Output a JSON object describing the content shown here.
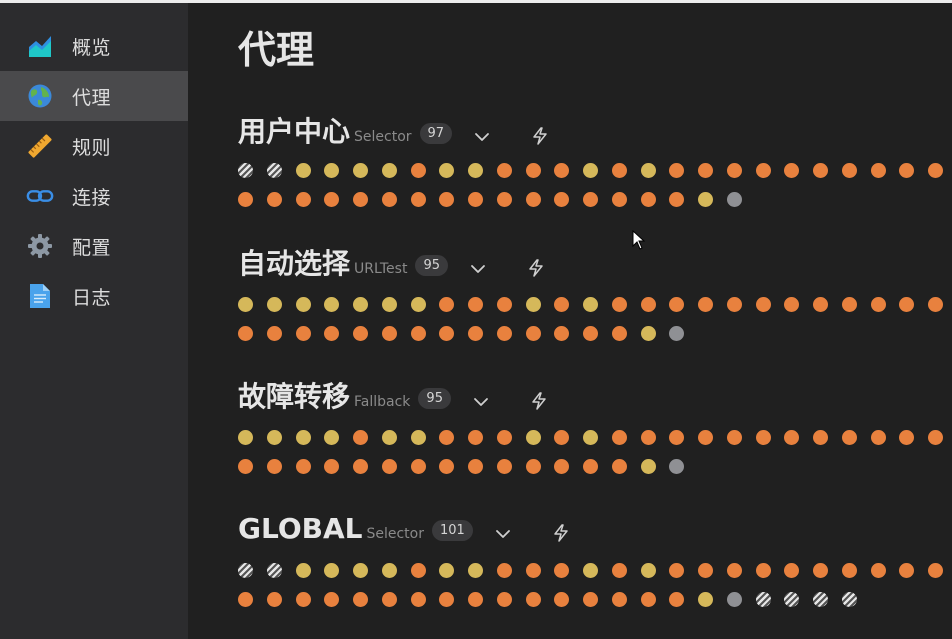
{
  "sidebar": {
    "items": [
      {
        "label": "概览",
        "icon": "chart-area-icon",
        "active": false
      },
      {
        "label": "代理",
        "icon": "globe-icon",
        "active": true
      },
      {
        "label": "规则",
        "icon": "ruler-icon",
        "active": false
      },
      {
        "label": "连接",
        "icon": "link-icon",
        "active": false
      },
      {
        "label": "配置",
        "icon": "gear-icon",
        "active": false
      },
      {
        "label": "日志",
        "icon": "document-icon",
        "active": false
      }
    ]
  },
  "page": {
    "title": "代理"
  },
  "groups": [
    {
      "name": "用户中心",
      "type": "Selector",
      "count": "97",
      "rows": [
        "SSYYYYOYYOOOYOYOOOOOOOOOOO",
        "OOOOOOOOOOOOOOOOYG"
      ]
    },
    {
      "name": "自动选择",
      "type": "URLTest",
      "count": "95",
      "rows": [
        "YYYYYYYOOOYOYOOOOOOOOOOOOO",
        "OOOOOOOOOOOOOOYG"
      ]
    },
    {
      "name": "故障转移",
      "type": "Fallback",
      "count": "95",
      "rows": [
        "YYYYOYYOOOYOYOOOOOOOOOOOOO",
        "OOOOOOOOOOOOOOYG"
      ]
    },
    {
      "name": "GLOBAL",
      "type": "Selector",
      "count": "101",
      "rows": [
        "SSYYYYOYYOOOYOYOOOOOOOOOOO",
        "OOOOOOOOOOOOOOOOYGSSSS"
      ]
    }
  ],
  "colors": {
    "orange": "#e8813e",
    "yellow": "#d5b85a",
    "gray": "#8f9094",
    "sidebar_bg": "#2c2c2e",
    "main_bg": "#202020",
    "active_bg": "#4a4a4c"
  },
  "icons": {
    "collapse": "chevron-down-icon",
    "test_latency": "lightning-icon"
  }
}
